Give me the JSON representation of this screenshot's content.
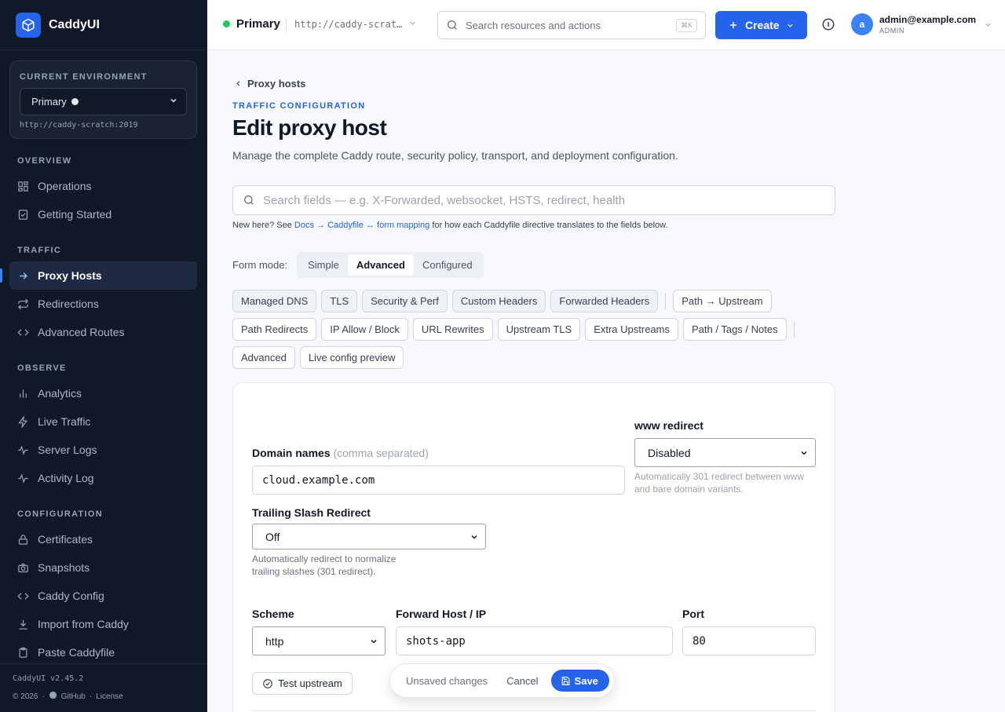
{
  "brand": {
    "name": "CaddyUI"
  },
  "sidebar": {
    "env_label": "CURRENT ENVIRONMENT",
    "env_selected": "Primary",
    "env_url": "http://caddy-scratch:2019",
    "sections": {
      "overview": "OVERVIEW",
      "traffic": "TRAFFIC",
      "observe": "OBSERVE",
      "configuration": "CONFIGURATION"
    },
    "items": {
      "operations": "Operations",
      "getting_started": "Getting Started",
      "proxy_hosts": "Proxy Hosts",
      "redirections": "Redirections",
      "advanced_routes": "Advanced Routes",
      "analytics": "Analytics",
      "live_traffic": "Live Traffic",
      "server_logs": "Server Logs",
      "activity_log": "Activity Log",
      "certificates": "Certificates",
      "snapshots": "Snapshots",
      "caddy_config": "Caddy Config",
      "import_from_caddy": "Import from Caddy",
      "paste_caddyfile": "Paste Caddyfile"
    },
    "footer": {
      "version": "CaddyUI v2.45.2",
      "copyright": "© 2026",
      "github": "GitHub",
      "license": "License"
    }
  },
  "topbar": {
    "env_name": "Primary",
    "env_url": "http://caddy-scrat…",
    "search_placeholder": "Search resources and actions",
    "search_shortcut": "⌘K",
    "create_label": "Create",
    "user_initial": "a",
    "user_email": "admin@example.com",
    "user_role": "ADMIN"
  },
  "page": {
    "back_label": "Proxy hosts",
    "eyebrow": "TRAFFIC CONFIGURATION",
    "title": "Edit proxy host",
    "subtitle": "Manage the complete Caddy route, security policy, transport, and deployment configuration.",
    "field_search_placeholder": "Search fields — e.g. X-Forwarded, websocket, HSTS, redirect, health",
    "help": {
      "prefix": "New here? See ",
      "link1": "Docs → Caddyfile ↔ form mapping",
      "suffix": " for how each Caddyfile directive translates to the fields below."
    },
    "form_mode": {
      "label": "Form mode:",
      "options": [
        "Simple",
        "Advanced",
        "Configured"
      ],
      "selected": "Advanced"
    },
    "sections": {
      "managed_dns": "Managed DNS",
      "tls": "TLS",
      "security_perf": "Security & Perf",
      "custom_headers": "Custom Headers",
      "forwarded_headers": "Forwarded Headers",
      "path_upstream": "Path → Upstream",
      "path_redirects": "Path Redirects",
      "ip_allow_block": "IP Allow / Block",
      "url_rewrites": "URL Rewrites",
      "upstream_tls": "Upstream TLS",
      "extra_upstreams": "Extra Upstreams",
      "path_tags_notes": "Path / Tags / Notes",
      "advanced": "Advanced",
      "live_config_preview": "Live config preview"
    }
  },
  "form": {
    "domain_label": "Domain names",
    "domain_hint": "(comma separated)",
    "domain_value": "cloud.example.com",
    "www_label": "www redirect",
    "www_value": "Disabled",
    "www_help": "Automatically 301 redirect between www and bare domain variants.",
    "trailing_label": "Trailing Slash Redirect",
    "trailing_value": "Off",
    "trailing_help": "Automatically redirect to normalize trailing slashes (301 redirect).",
    "scheme_label": "Scheme",
    "scheme_value": "http",
    "host_label": "Forward Host / IP",
    "host_value": "shots-app",
    "port_label": "Port",
    "port_value": "80",
    "test_label": "Test upstream"
  },
  "savebar": {
    "status": "Unsaved changes",
    "cancel": "Cancel",
    "save": "Save"
  },
  "colors": {
    "accent": "#2563eb",
    "sidebar_bg": "#111827",
    "status_green": "#22c55e"
  }
}
